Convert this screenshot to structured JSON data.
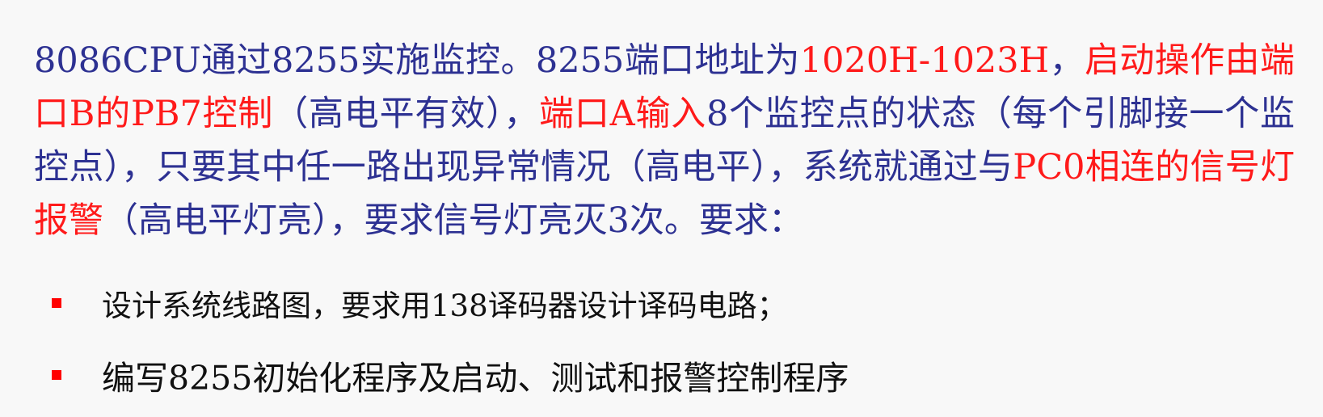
{
  "problem": {
    "segments": [
      {
        "text": "8086CPU通过8255实施监控。8255端口地址为",
        "highlight": false
      },
      {
        "text": "1020H-1023H",
        "highlight": true
      },
      {
        "text": "，",
        "highlight": false
      },
      {
        "text": "启动操作由端口B的PB7控制",
        "highlight": true
      },
      {
        "text": "（高电平有效），",
        "highlight": false
      },
      {
        "text": "端口A输入",
        "highlight": true
      },
      {
        "text": "8个监控点的状态（每个引脚接一个监控点），只要其中任一路出现异常情况（高电平），系统就通过与",
        "highlight": false
      },
      {
        "text": "PC0相连的信号灯报警",
        "highlight": true
      },
      {
        "text": "（高电平灯亮），要求信号灯亮灭3次。要求：",
        "highlight": false
      }
    ]
  },
  "requirements": [
    "设计系统线路图，要求用138译码器设计译码电路；",
    "编写8255初始化程序及启动、测试和报警控制程序"
  ],
  "colors": {
    "body_text": "#2d3192",
    "highlight": "#ff1a1a",
    "bullet_marker": "#ff0000",
    "bullet_text": "#111111",
    "background": "#f8f8f8"
  }
}
